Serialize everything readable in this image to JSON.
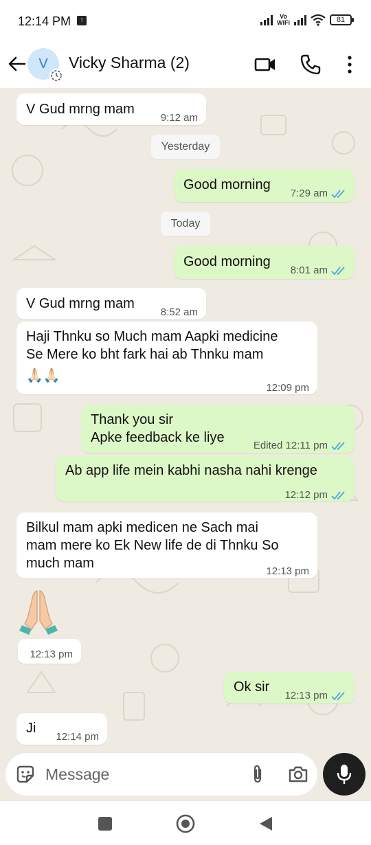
{
  "status_bar": {
    "time": "12:14 PM",
    "vowifi_top": "Vo",
    "vowifi_bottom": "WiFi",
    "battery": "81"
  },
  "header": {
    "back_icon": "arrow-left-icon",
    "avatar_letter": "V",
    "contact_name": "Vicky Sharma (2)",
    "actions": [
      "video-call-icon",
      "phone-icon",
      "more-vert-icon"
    ]
  },
  "chat": {
    "messages": [
      {
        "dir": "in",
        "text": "V Gud mrng mam",
        "time": "9:12 am"
      },
      {
        "type": "date",
        "label": "Yesterday"
      },
      {
        "dir": "out",
        "text": "Good morning",
        "time": "7:29 am",
        "read": true
      },
      {
        "type": "date",
        "label": "Today"
      },
      {
        "dir": "out",
        "text": "Good morning",
        "time": "8:01 am",
        "read": true
      },
      {
        "dir": "in",
        "text": "V Gud mrng mam",
        "time": "8:52 am"
      },
      {
        "dir": "in",
        "line1": "Haji Thnku so Much mam Aapki medicine",
        "line2": "Se Mere ko bht fark hai ab Thnku mam",
        "emoji": "🙏🏻🙏🏻",
        "time": "12:09 pm"
      },
      {
        "dir": "out",
        "line1": "Thank you sir",
        "line2": "Apke feedback ke liye",
        "time": "Edited 12:11 pm",
        "read": true
      },
      {
        "dir": "out",
        "text": "Ab app life mein kabhi nasha  nahi krenge",
        "time": "12:12 pm",
        "read": true
      },
      {
        "dir": "in",
        "line1": "Bilkul mam apki medicen ne Sach mai",
        "line2": "mam mere ko Ek New life de di Thnku So",
        "line3": "much mam",
        "time": "12:13 pm"
      },
      {
        "dir": "in",
        "emoji_only": "folded-hands-icon",
        "time": "12:13 pm"
      },
      {
        "dir": "out",
        "text": "Ok sir",
        "time": "12:13 pm",
        "read": true
      },
      {
        "dir": "in",
        "text": "Ji",
        "time": "12:14 pm"
      }
    ]
  },
  "composer": {
    "placeholder": "Message",
    "icons": [
      "sticker-icon",
      "attach-icon",
      "camera-icon",
      "mic-icon"
    ]
  },
  "navbar": {
    "buttons": [
      "recents-button",
      "home-button",
      "back-nav-button"
    ]
  },
  "colors": {
    "incoming": "#ffffff",
    "outgoing": "#dcf8c6",
    "chat_bg": "#efeae2",
    "read_ticks": "#4fa3e0"
  }
}
